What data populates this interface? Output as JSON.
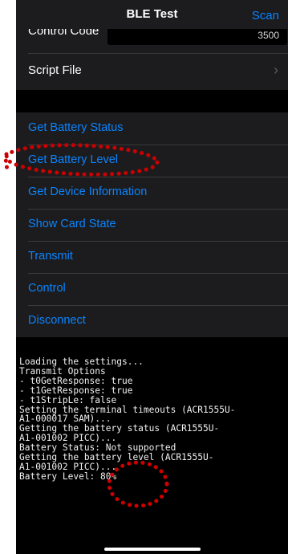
{
  "navbar": {
    "title": "BLE Test",
    "scan_label": "Scan"
  },
  "settings": {
    "control_code_label": "Control Code",
    "control_code_value": "3500",
    "script_file_label": "Script File",
    "chevron_icon": "chevron-right-icon"
  },
  "actions": [
    {
      "label": "Get Battery Status"
    },
    {
      "label": "Get Battery Level"
    },
    {
      "label": "Get Device Information"
    },
    {
      "label": "Show Card State"
    },
    {
      "label": "Transmit"
    },
    {
      "label": "Control"
    },
    {
      "label": "Disconnect"
    }
  ],
  "log": {
    "text": "Loading the settings...\nTransmit Options\n- t0GetResponse: true\n- t1GetResponse: true\n- t1StripLe: false\nSetting the terminal timeouts (ACR1555U-\nA1-000017 SAM)...\nGetting the battery status (ACR1555U-\nA1-001002 PICC)...\nBattery Status: Not supported\nGetting the battery level (ACR1555U-\nA1-001002 PICC)...\nBattery Level: 80%"
  },
  "colors": {
    "accent": "#0a84ff",
    "annotation": "#cc0000",
    "cell_background": "#1c1c1e",
    "screen_background": "#000000"
  }
}
